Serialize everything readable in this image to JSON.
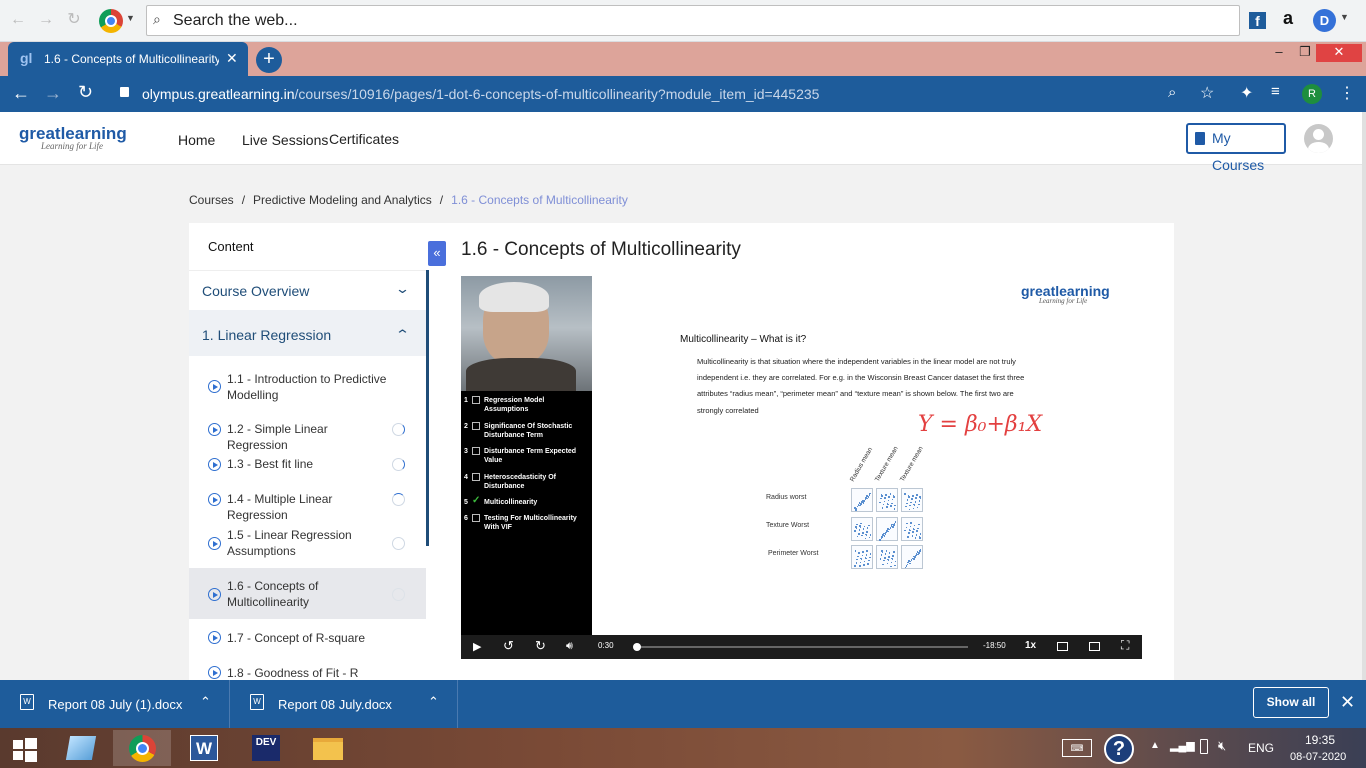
{
  "browser": {
    "search_placeholder": "Search the web...",
    "tab_title": "1.6 - Concepts of Multicollinearity",
    "url_host": "olympus.greatlearning.in",
    "url_path": "/courses/10916/pages/1-dot-6-concepts-of-multicollinearity?module_item_id=445235",
    "profile_initial": "R",
    "extension_letter": "D",
    "amazon_letter": "a",
    "facebook_letter": "f"
  },
  "site": {
    "logo_text_a": "great",
    "logo_text_b": "learning",
    "logo_tagline": "Learning for Life",
    "nav": [
      "Home",
      "Live Sessions",
      "Certificates"
    ],
    "my_courses": "My Courses"
  },
  "breadcrumb": {
    "items": [
      "Courses",
      "Predictive Modeling and Analytics"
    ],
    "current": "1.6 - Concepts of Multicollinearity",
    "separator": "/"
  },
  "sidebar": {
    "header": "Content",
    "sections": [
      {
        "label": "Course Overview",
        "expanded": false
      },
      {
        "label": "1. Linear Regression",
        "expanded": true
      }
    ],
    "items": [
      {
        "label": "1.1 - Introduction to Predictive Modelling",
        "progress": false
      },
      {
        "label": "1.2 - Simple Linear Regression",
        "progress": true
      },
      {
        "label": "1.3 - Best fit line",
        "progress": true
      },
      {
        "label": "1.4 - Multiple Linear Regression",
        "progress": true
      },
      {
        "label": "1.5 - Linear Regression Assumptions",
        "progress": true
      },
      {
        "label": "1.6 - Concepts of Multicollinearity",
        "progress": true
      },
      {
        "label": "1.7 - Concept of R-square",
        "progress": false
      },
      {
        "label": "1.8 - Goodness of Fit - R Square",
        "progress": false
      }
    ],
    "active_index": 5
  },
  "main": {
    "title": "1.6 - Concepts of Multicollinearity",
    "collapse_glyph": "«"
  },
  "video": {
    "toc": [
      {
        "n": "1",
        "label": "Regression Model Assumptions",
        "checked": false
      },
      {
        "n": "2",
        "label": "Significance Of Stochastic Disturbance Term",
        "checked": false
      },
      {
        "n": "3",
        "label": "Disturbance Term Expected Value",
        "checked": false
      },
      {
        "n": "4",
        "label": "Heteroscedasticity Of Disturbance",
        "checked": false
      },
      {
        "n": "5",
        "label": "Multicollinearity",
        "checked": true
      },
      {
        "n": "6",
        "label": "Testing For Multicollinearity With VIF",
        "checked": false
      }
    ],
    "elapsed": "0:30",
    "remaining": "-18:50",
    "speed": "1x",
    "progress_fraction": 0.01
  },
  "slide": {
    "logo_a": "great",
    "logo_b": "learning",
    "logo_tagline": "Learning for Life",
    "heading": "Multicollinearity – What is it?",
    "paragraph_lines": [
      "Multicollinearity is that situation where the independent variables in the linear model are not truly",
      "independent i.e. they are correlated. For e.g. in the Wisconsin Breast Cancer dataset the first three",
      "attributes “radius mean”, “perimeter mean” and “texture mean”  is shown below. The first two are",
      "strongly correlated"
    ],
    "handwriting": "Y = β₀+β₁X",
    "matrix_columns": [
      "Radius mean",
      "Texture mean",
      "Texture mean"
    ],
    "matrix_rows": [
      "Radius worst",
      "Texture Worst",
      "Perimeter Worst"
    ]
  },
  "downloads": {
    "files": [
      "Report 08 July (1).docx",
      "Report 08 July.docx"
    ],
    "show_all": "Show all"
  },
  "taskbar": {
    "apps": [
      "explorer",
      "chrome",
      "word",
      "devc",
      "files"
    ],
    "dev_label": "DEV",
    "language": "ENG",
    "time": "19:35",
    "date": "08-07-2020"
  },
  "colors": {
    "brand_blue": "#1e5c9b",
    "tab_strip": "#dda49a",
    "accent": "#1f5aa6"
  }
}
